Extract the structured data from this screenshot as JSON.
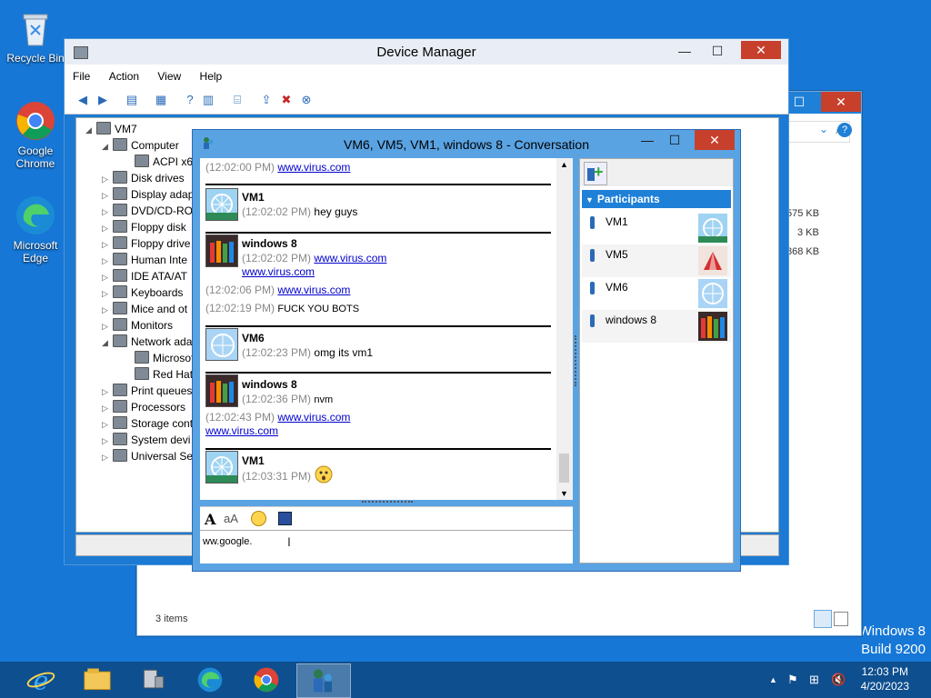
{
  "desktop": {
    "icons": [
      {
        "label": "Recycle Bin"
      },
      {
        "label": "Google Chrome"
      },
      {
        "label": "Microsoft Edge"
      }
    ],
    "watermark_line1": "Windows 8",
    "watermark_line2": "Build 9200"
  },
  "explorer": {
    "status": "3 items",
    "sizes": [
      "575 KB",
      "3 KB",
      "868 KB"
    ]
  },
  "devmgr": {
    "title": "Device Manager",
    "menu": [
      "File",
      "Action",
      "View",
      "Help"
    ],
    "tree": [
      {
        "label": "VM7"
      },
      {
        "label": "Computer"
      },
      {
        "label": "ACPI x64"
      },
      {
        "label": "Disk drives"
      },
      {
        "label": "Display adap"
      },
      {
        "label": "DVD/CD-RO"
      },
      {
        "label": "Floppy disk"
      },
      {
        "label": "Floppy drive"
      },
      {
        "label": "Human Inte"
      },
      {
        "label": "IDE ATA/AT"
      },
      {
        "label": "Keyboards"
      },
      {
        "label": "Mice and ot"
      },
      {
        "label": "Monitors"
      },
      {
        "label": "Network ada"
      },
      {
        "label": "Microsof"
      },
      {
        "label": "Red Hat"
      },
      {
        "label": "Print queues"
      },
      {
        "label": "Processors"
      },
      {
        "label": "Storage cont"
      },
      {
        "label": "System devi"
      },
      {
        "label": "Universal Se"
      }
    ]
  },
  "conversation": {
    "title": "VM6, VM5, VM1, windows 8 - Conversation",
    "messages": {
      "m0_ts": "(12:02:00 PM)",
      "m0_link": "www.virus.com",
      "m1_nick": "VM1",
      "m1_ts": "(12:02:02 PM)",
      "m1_text": "hey guys",
      "m2_nick": "windows 8",
      "m2_ts": "(12:02:02 PM)",
      "m2_link": "www.virus.com",
      "m2_link2": "www.virus.com",
      "m3_ts": "(12:02:06 PM)",
      "m3_link": "www.virus.com",
      "m4_ts": "(12:02:19 PM)",
      "m4_text": "FUCK YOU BOTS",
      "m5_nick": "VM6",
      "m5_ts": "(12:02:23 PM)",
      "m5_text": "omg its vm1",
      "m6_nick": "windows 8",
      "m6_ts": "(12:02:36 PM)",
      "m6_text": "nvm",
      "m7_ts": "(12:02:43 PM)",
      "m7_link": "www.virus.com",
      "m7_link2": "www.virus.com",
      "m8_nick": "VM1",
      "m8_ts": "(12:03:31 PM)"
    },
    "input_value": "ww.google.",
    "participants_header": "Participants",
    "participants": [
      {
        "name": "VM1"
      },
      {
        "name": "VM5"
      },
      {
        "name": "VM6"
      },
      {
        "name": "windows 8"
      }
    ]
  },
  "taskbar": {
    "time": "12:03 PM",
    "date": "4/20/2023"
  }
}
